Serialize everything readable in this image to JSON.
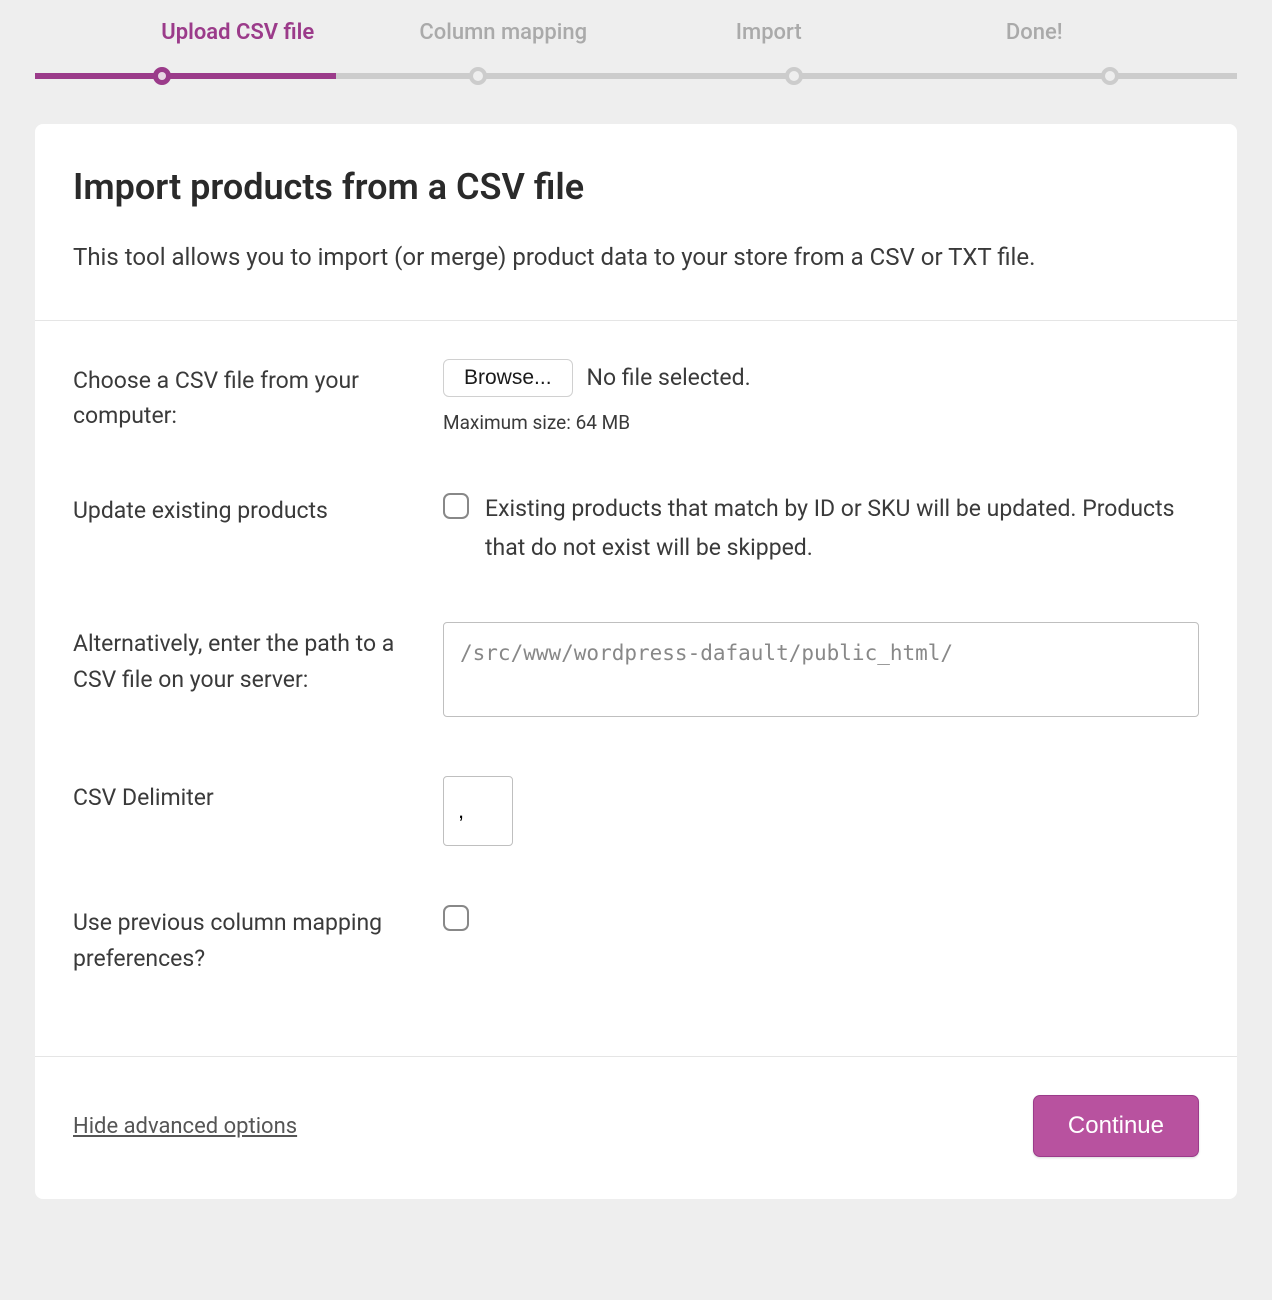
{
  "stepper": {
    "steps": [
      {
        "label": "Upload CSV file",
        "active": true
      },
      {
        "label": "Column mapping",
        "active": false
      },
      {
        "label": "Import",
        "active": false
      },
      {
        "label": "Done!",
        "active": false
      }
    ]
  },
  "header": {
    "title": "Import products from a CSV file",
    "description": "This tool allows you to import (or merge) product data to your store from a CSV or TXT file."
  },
  "form": {
    "choose_file_label": "Choose a CSV file from your computer:",
    "browse_button": "Browse...",
    "file_status": "No file selected.",
    "max_size_hint": "Maximum size: 64 MB",
    "update_existing_label": "Update existing products",
    "update_existing_desc": "Existing products that match by ID or SKU will be updated. Products that do not exist will be skipped.",
    "server_path_label": "Alternatively, enter the path to a CSV file on your server:",
    "server_path_placeholder": "/src/www/wordpress-dafault/public_html/",
    "delimiter_label": "CSV Delimiter",
    "delimiter_value": ",",
    "previous_mapping_label": "Use previous column mapping preferences?"
  },
  "footer": {
    "toggle_link": "Hide advanced options",
    "continue_button": "Continue"
  }
}
